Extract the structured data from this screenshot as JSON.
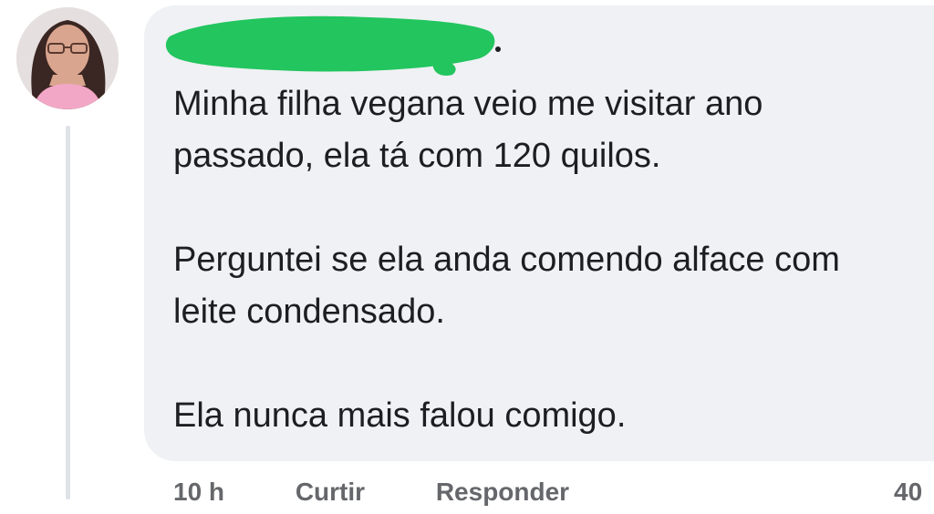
{
  "comment": {
    "author": {
      "name": "",
      "name_redacted": true
    },
    "text": "Minha filha vegana veio me visitar ano\npassado, ela tá com 120 quilos.\n\nPerguntei se ela anda comendo alface com\nleite condensado.\n\nEla nunca mais falou comigo."
  },
  "actions": {
    "time": "10 h",
    "like": "Curtir",
    "reply": "Responder",
    "reactions_count": "40"
  },
  "colors": {
    "bubble": "#eff1f4",
    "text": "#1c1e21",
    "redaction": "#22c55e",
    "thread_line": "#dfe2e7"
  },
  "icons": [
    "avatar-photo"
  ]
}
